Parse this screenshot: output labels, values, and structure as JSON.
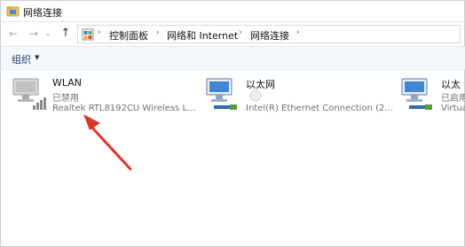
{
  "window": {
    "title": "网络连接"
  },
  "nav": {
    "back_icon": "back-arrow-icon",
    "forward_icon": "forward-arrow-icon",
    "up_icon": "up-arrow-icon",
    "breadcrumb": [
      "控制面板",
      "网络和 Internet",
      "网络连接"
    ]
  },
  "toolbar": {
    "organize_label": "组织"
  },
  "connections": [
    {
      "name": "WLAN",
      "status": "已禁用",
      "adapter": "Realtek RTL8192CU Wireless L..."
    },
    {
      "name": "以太网",
      "status": "",
      "adapter": "Intel(R) Ethernet Connection (2..."
    },
    {
      "name": "以太",
      "status": "已启用",
      "adapter": "Virtua"
    }
  ],
  "colors": {
    "accent": "#1e3f6a",
    "annotation_arrow": "#e0342b"
  }
}
